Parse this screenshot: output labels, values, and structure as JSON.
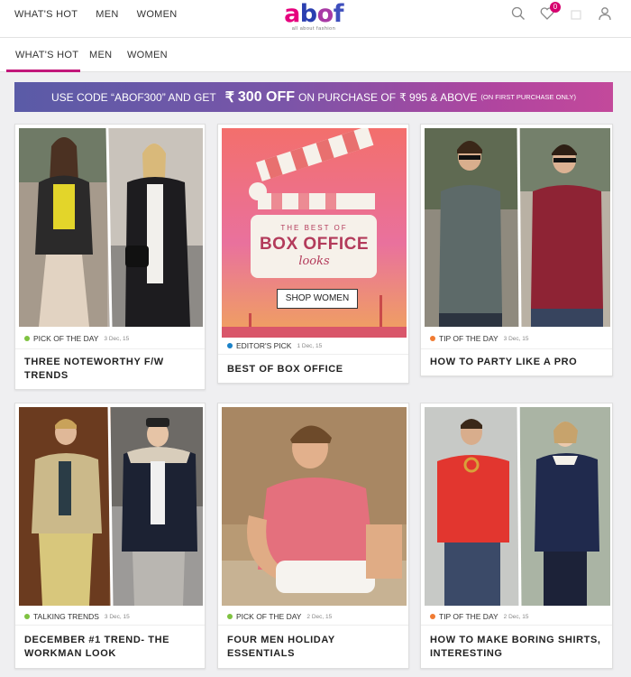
{
  "header": {
    "nav": [
      "WHAT'S HOT",
      "MEN",
      "WOMEN"
    ],
    "logo_text": "abof",
    "logo_tagline": "all about fashion",
    "wishlist_count": "0"
  },
  "tabs": [
    "WHAT'S HOT",
    "MEN",
    "WOMEN"
  ],
  "promo": {
    "part1": "USE CODE “ABOF300” AND GET",
    "rupee": "₹",
    "amount": "300 OFF",
    "part2": "ON PURCHASE OF",
    "threshold": "₹ 995 & ABOVE",
    "note": "(ON FIRST PURCHASE ONLY)"
  },
  "colors": {
    "accent": "#c2177a",
    "green": "#7fc241",
    "blue": "#1b82c8",
    "orange": "#f07b32"
  },
  "cards": [
    {
      "tag": "PICK OF THE DAY",
      "date": "3 Dec, 15",
      "title": "THREE NOTEWORTHY F/W TRENDS",
      "dot": "green"
    },
    {
      "tag": "EDITOR'S PICK",
      "date": "1 Dec, 15",
      "title": "BEST OF BOX OFFICE",
      "dot": "blue",
      "art_line1": "THE BEST OF",
      "art_line2": "BOX OFFICE",
      "art_line3": "looks",
      "button": "SHOP WOMEN"
    },
    {
      "tag": "TIP OF THE DAY",
      "date": "3 Dec, 15",
      "title": "HOW TO PARTY LIKE A PRO",
      "dot": "orange"
    },
    {
      "tag": "TALKING TRENDS",
      "date": "3 Dec, 15",
      "title": "DECEMBER #1 TREND- THE WORKMAN LOOK",
      "dot": "green"
    },
    {
      "tag": "PICK OF THE DAY",
      "date": "2 Dec, 15",
      "title": "FOUR MEN HOLIDAY ESSENTIALS",
      "dot": "green"
    },
    {
      "tag": "TIP OF THE DAY",
      "date": "2 Dec, 15",
      "title": "HOW TO MAKE BORING SHIRTS, INTERESTING",
      "dot": "orange"
    }
  ]
}
